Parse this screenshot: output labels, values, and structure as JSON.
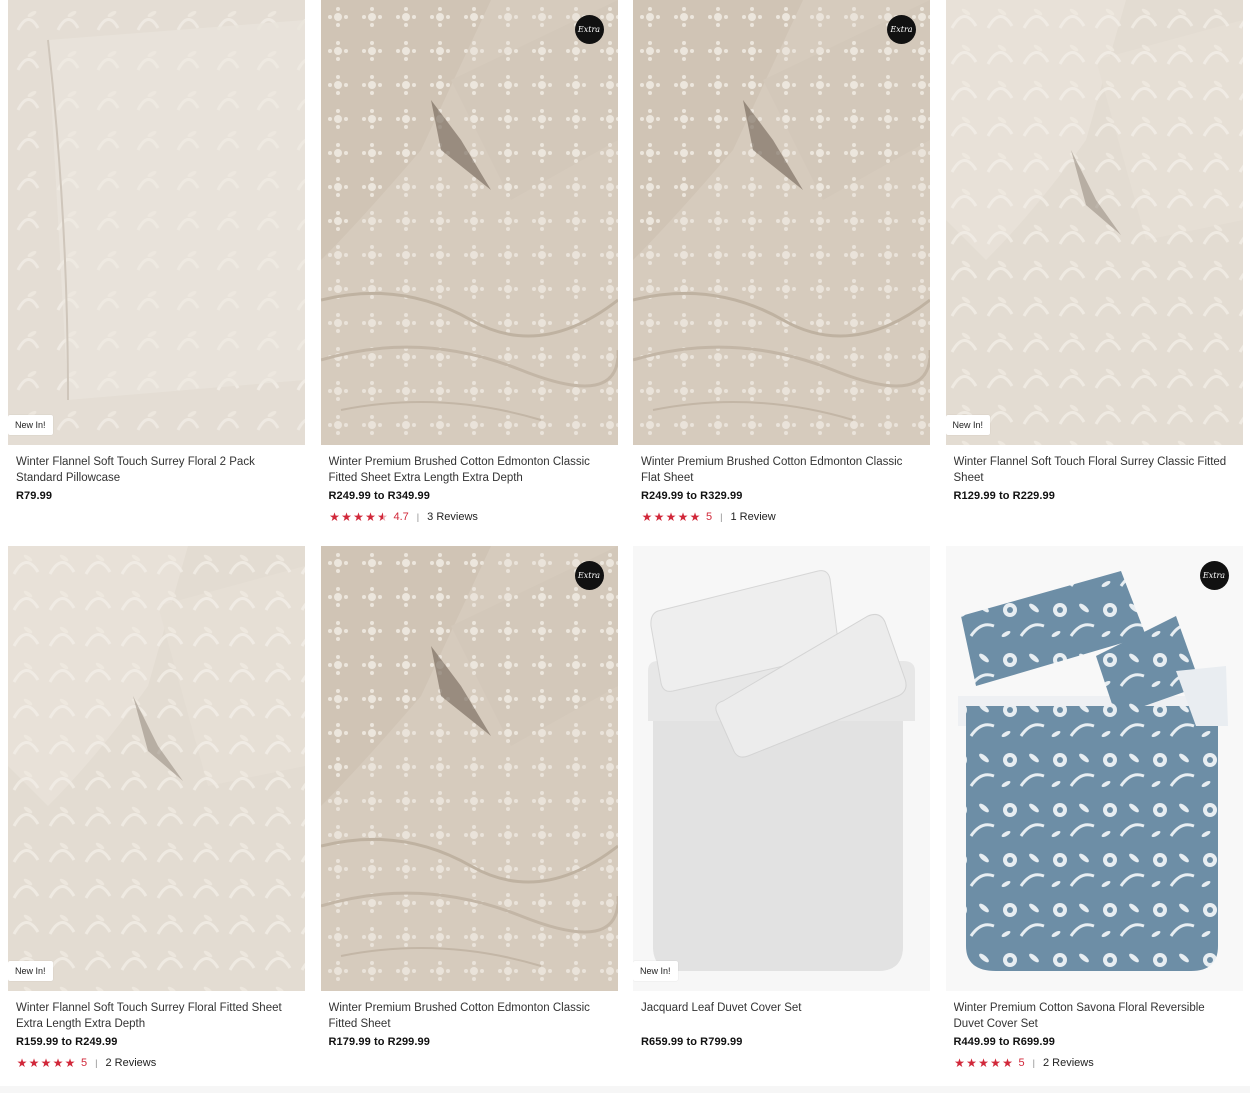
{
  "products": [
    {
      "title": "Winter Flannel Soft Touch Surrey Floral 2 Pack Standard Pillowcase",
      "price": "R79.99",
      "badge": "New In!",
      "extra_badge": "",
      "rating": "",
      "reviews": "",
      "image": "beige-leaf-pillowcase"
    },
    {
      "title": "Winter Premium Brushed Cotton Edmonton Classic Fitted Sheet Extra Length Extra Depth",
      "price": "R249.99 to R349.99",
      "badge": "",
      "extra_badge": "Extra",
      "rating": "4.7",
      "stars": 4.7,
      "reviews": "3 Reviews",
      "image": "beige-snowflake-sheet"
    },
    {
      "title": "Winter Premium Brushed Cotton Edmonton Classic Flat Sheet",
      "price": "R249.99 to R329.99",
      "badge": "",
      "extra_badge": "Extra",
      "rating": "5",
      "stars": 5,
      "reviews": "1 Review",
      "image": "beige-snowflake-sheet"
    },
    {
      "title": "Winter Flannel Soft Touch Floral Surrey Classic Fitted Sheet",
      "price": "R129.99 to R229.99",
      "badge": "New In!",
      "extra_badge": "",
      "rating": "",
      "reviews": "",
      "image": "beige-leaf-sheet"
    },
    {
      "title": "Winter Flannel Soft Touch Surrey Floral Fitted Sheet Extra Length Extra Depth",
      "price": "R159.99 to R249.99",
      "badge": "New In!",
      "extra_badge": "",
      "rating": "5",
      "stars": 5,
      "reviews": "2 Reviews",
      "image": "beige-leaf-sheet"
    },
    {
      "title": "Winter Premium Brushed Cotton Edmonton Classic Fitted Sheet",
      "price": "R179.99 to R299.99",
      "badge": "",
      "extra_badge": "Extra",
      "rating": "",
      "reviews": "",
      "image": "beige-snowflake-sheet"
    },
    {
      "title": "Jacquard Leaf Duvet Cover Set",
      "price": "R659.99 to R799.99",
      "badge": "New In!",
      "extra_badge": "",
      "rating": "",
      "reviews": "",
      "image": "white-duvet-set"
    },
    {
      "title": "Winter Premium Cotton Savona Floral Reversible Duvet Cover Set",
      "price": "R449.99 to R699.99",
      "badge": "",
      "extra_badge": "Extra",
      "rating": "5",
      "stars": 5,
      "reviews": "2 Reviews",
      "image": "blue-floral-duvet-set"
    }
  ],
  "colors": {
    "star": "#d1283a",
    "beige": "#d9d1c6",
    "blue": "#6f8fa6"
  }
}
